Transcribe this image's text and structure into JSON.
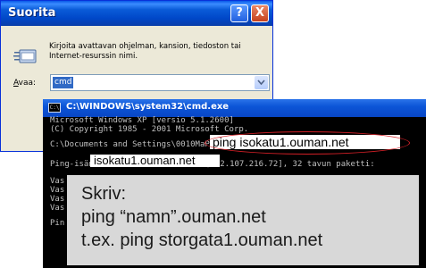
{
  "run_dialog": {
    "title": "Suorita",
    "help_glyph": "?",
    "close_glyph": "X",
    "icon": "run-program-icon",
    "description": "Kirjoita avattavan ohjelman, kansion, tiedoston tai Internet-resurssin nimi.",
    "open_label_access_key": "A",
    "open_label_rest": "vaa:",
    "open_value": "cmd"
  },
  "console": {
    "title": "C:\\WINDOWS\\system32\\cmd.exe",
    "icon_text": "C:\\",
    "lines": {
      "version": "Microsoft Windows XP [versio 5.1.2600]",
      "copyright": "(C) Copyright 1985 - 2001 Microsoft Corp.",
      "prompt": "C:\\Documents and Settings\\0010MaPa>",
      "reply_prefix": "Ping-isäntä",
      "reply_suffix": "[192.107.216.72], 32 tavun paketti:",
      "partial_1": "Vas",
      "partial_2": "Vas",
      "partial_3": "Vas",
      "partial_4": "Vas",
      "partial_5": "Pin"
    },
    "typed_command": "ping isokatu1.ouman.net",
    "reply_host": "isokatu1.ouman.net"
  },
  "instruction": {
    "line1": "Skriv:",
    "line2": "ping “namn”.ouman.net",
    "line3": "t.ex. ping storgata1.ouman.net"
  },
  "colors": {
    "highlight_oval": "#d31f26",
    "instruction_bg": "#d8d8d8",
    "console_text": "#c0c0c0"
  }
}
